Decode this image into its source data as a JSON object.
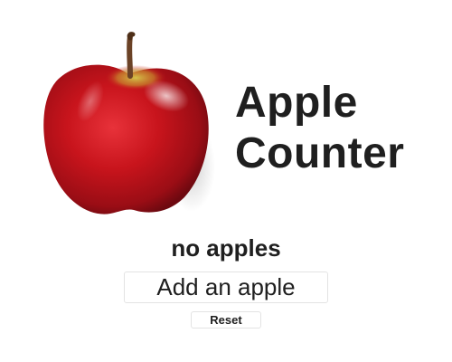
{
  "header": {
    "title_line1": "Apple",
    "title_line2": "Counter",
    "image_icon": "red-apple-icon"
  },
  "counter": {
    "status_text": "no apples",
    "add_label": "Add an apple",
    "reset_label": "Reset"
  },
  "colors": {
    "apple_red": "#c8141c",
    "apple_dark_red": "#7e0b12",
    "apple_yellow_green": "#b8b23a",
    "stem": "#6b4226",
    "text": "#1f1f1f",
    "button_border": "#e3e3e3"
  }
}
